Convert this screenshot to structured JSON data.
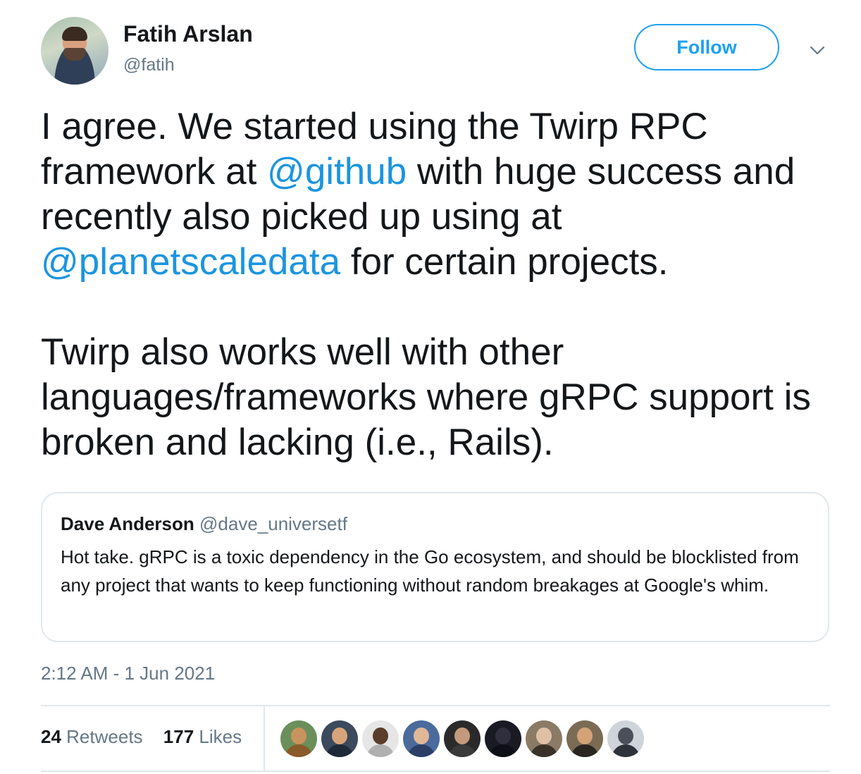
{
  "author": {
    "name": "Fatih Arslan",
    "handle": "@fatih",
    "avatar_icon": "user-avatar"
  },
  "follow_label": "Follow",
  "menu_icon": "chevron-down-icon",
  "tweet": {
    "p1": {
      "t1": "I agree. We started using the Twirp RPC framework at ",
      "m1": "@github",
      "t2": " with huge success and recently also picked up using at ",
      "m2": "@planetscaledata",
      "t3": " for certain projects."
    },
    "p2": "Twirp also works well with other languages/frameworks where gRPC support is broken and lacking (i.e., Rails)."
  },
  "quote": {
    "name": "Dave Anderson",
    "handle": "@dave_universetf",
    "text": "Hot take. gRPC is a toxic dependency in the Go ecosystem, and should be blocklisted from any project that wants to keep functioning without random breakages at Google's whim."
  },
  "timestamp": "2:12 AM - 1 Jun 2021",
  "stats": {
    "retweets_count": "24",
    "retweets_label": "Retweets",
    "likes_count": "177",
    "likes_label": "Likes"
  },
  "colors": {
    "accent": "#1da1f2",
    "mention": "#1b95e0",
    "secondary_text": "#657786",
    "border": "#e1e8ed"
  },
  "likers": [
    {
      "bg": "#6b8f5a",
      "face": "#c9935f",
      "body": "#8a5a2a"
    },
    {
      "bg": "#3b4a5c",
      "face": "#d8a47c",
      "body": "#1f2a38"
    },
    {
      "bg": "#e6e6e6",
      "face": "#5a3d2b",
      "body": "#b0b0b0"
    },
    {
      "bg": "#4a6b9c",
      "face": "#e0b896",
      "body": "#2c3e66"
    },
    {
      "bg": "#2a2a2a",
      "face": "#c49a7c",
      "body": "#3a3a3a"
    },
    {
      "bg": "#1a1a24",
      "face": "#2f2f3d",
      "body": "#0e0e16"
    },
    {
      "bg": "#8a7a66",
      "face": "#e0c0a4",
      "body": "#3a3228"
    },
    {
      "bg": "#7a6b55",
      "face": "#d4a277",
      "body": "#2b2520"
    },
    {
      "bg": "#cfd4da",
      "face": "#4a4f5a",
      "body": "#2e323a"
    }
  ]
}
